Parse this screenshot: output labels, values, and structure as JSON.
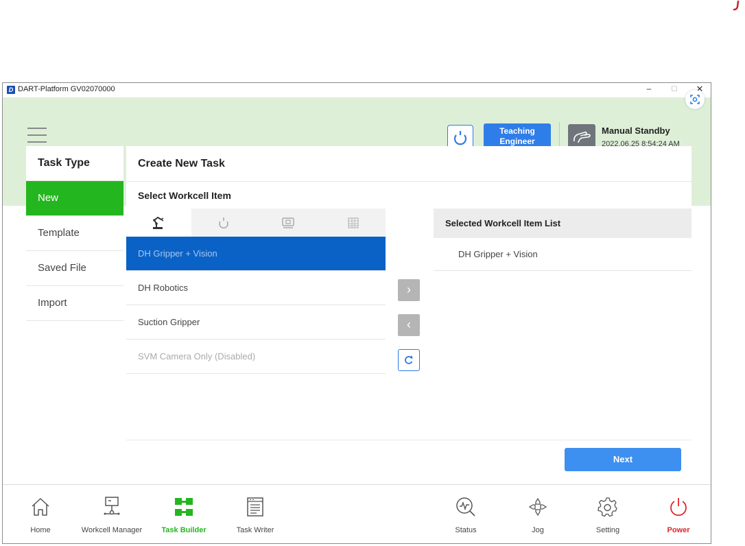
{
  "window": {
    "title": "DART-Platform GV02070000",
    "logo_letter": "D",
    "minimize_glyph": "–",
    "maximize_glyph": "☐",
    "close_glyph": "✕"
  },
  "header": {
    "role_line1": "Teaching",
    "role_line2": "Engineer",
    "mode_title": "Manual Standby",
    "mode_time": "2022.06.25 8:54:24 AM"
  },
  "task_type": {
    "heading": "Task Type",
    "items": [
      {
        "label": "New",
        "active": true
      },
      {
        "label": "Template",
        "active": false
      },
      {
        "label": "Saved File",
        "active": false
      },
      {
        "label": "Import",
        "active": false
      }
    ]
  },
  "main": {
    "title": "Create New Task",
    "subtitle": "Select Workcell Item",
    "tabs": [
      {
        "icon": "robot-arm-icon",
        "active": true
      },
      {
        "icon": "rotate-icon",
        "active": false
      },
      {
        "icon": "display-icon",
        "active": false
      },
      {
        "icon": "grid-icon",
        "active": false
      }
    ],
    "items": [
      {
        "label": "DH Gripper + Vision",
        "state": "selected"
      },
      {
        "label": "DH Robotics",
        "state": "normal"
      },
      {
        "label": "Suction Gripper",
        "state": "normal"
      },
      {
        "label": "SVM Camera Only (Disabled)",
        "state": "disabled"
      }
    ],
    "add_arrow": "›",
    "remove_arrow": "‹",
    "selected_list_heading": "Selected Workcell Item List",
    "selected_items": [
      "DH Gripper + Vision"
    ],
    "next_label": "Next"
  },
  "bottom_nav": {
    "home": "Home",
    "workcell_manager": "Workcell Manager",
    "task_builder": "Task Builder",
    "task_writer": "Task Writer",
    "status": "Status",
    "jog": "Jog",
    "setting": "Setting",
    "power": "Power"
  },
  "colors": {
    "accent_green": "#23b61e",
    "accent_blue": "#2f7de8",
    "selected_blue": "#0b62c6",
    "power_red": "#e0242a",
    "header_bg": "#deefd8"
  }
}
